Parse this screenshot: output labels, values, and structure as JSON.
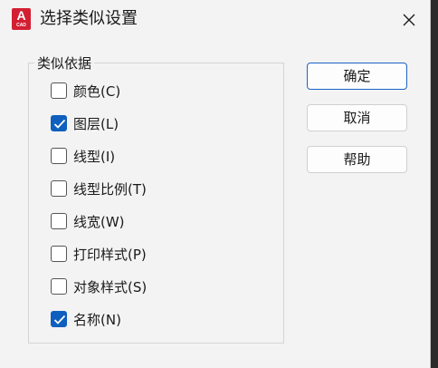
{
  "window": {
    "title": "选择类似设置",
    "app_icon_letter": "A",
    "app_icon_caption": "CAD"
  },
  "group": {
    "legend": "类似依据",
    "items": [
      {
        "label": "颜色(C)",
        "checked": false
      },
      {
        "label": "图层(L)",
        "checked": true
      },
      {
        "label": "线型(I)",
        "checked": false
      },
      {
        "label": "线型比例(T)",
        "checked": false
      },
      {
        "label": "线宽(W)",
        "checked": false
      },
      {
        "label": "打印样式(P)",
        "checked": false
      },
      {
        "label": "对象样式(S)",
        "checked": false
      },
      {
        "label": "名称(N)",
        "checked": true
      }
    ]
  },
  "buttons": {
    "ok": "确定",
    "cancel": "取消",
    "help": "帮助"
  },
  "colors": {
    "accent": "#0f5fbe",
    "app_icon": "#d31f32"
  }
}
